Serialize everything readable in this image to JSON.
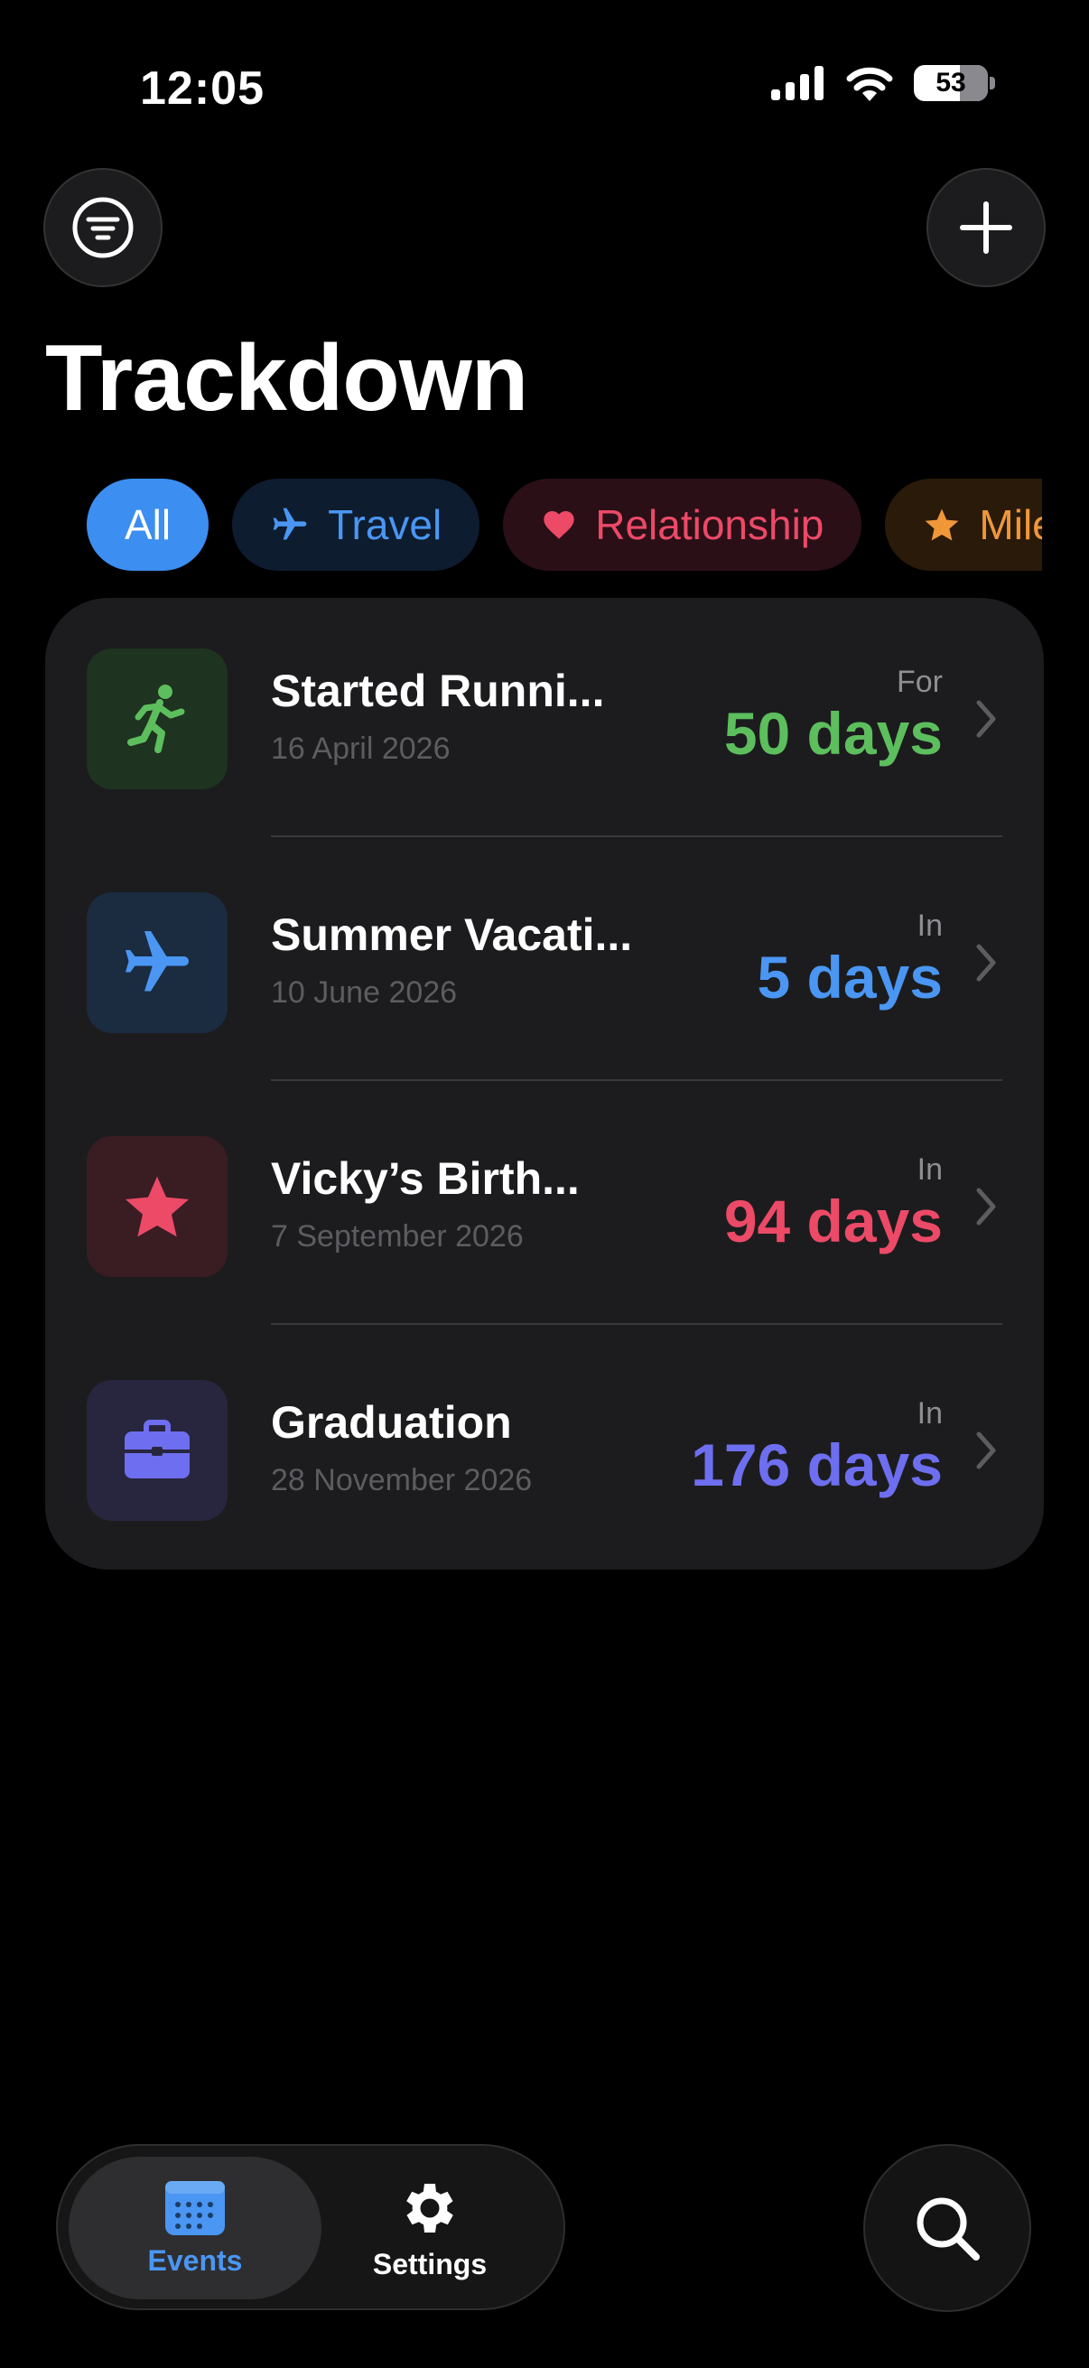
{
  "status": {
    "time": "12:05",
    "battery": "53"
  },
  "header": {
    "title": "Trackdown",
    "filter_icon": "filter-circle-icon",
    "add_icon": "plus-icon"
  },
  "chips": [
    {
      "label": "All",
      "icon": "",
      "color": "#3c8ef0"
    },
    {
      "label": "Travel",
      "icon": "airplane-icon",
      "color": "#4a96f2"
    },
    {
      "label": "Relationship",
      "icon": "heart-icon",
      "color": "#ec4a67"
    },
    {
      "label": "Mile",
      "icon": "star-icon",
      "color": "#f0973a"
    }
  ],
  "events": [
    {
      "name": "Started Runni...",
      "date": "16 April 2026",
      "prefix": "For",
      "count": "50 days",
      "icon": "running-figure-icon",
      "color": "#5dbe5d"
    },
    {
      "name": "Summer Vacati...",
      "date": "10 June 2026",
      "prefix": "In",
      "count": "5 days",
      "icon": "airplane-icon",
      "color": "#4a96f2"
    },
    {
      "name": "Vicky’s Birth...",
      "date": "7 September 2026",
      "prefix": "In",
      "count": "94 days",
      "icon": "star-icon",
      "color": "#ec4a67"
    },
    {
      "name": "Graduation",
      "date": "28 November 2026",
      "prefix": "In",
      "count": "176 days",
      "icon": "briefcase-icon",
      "color": "#6e6ef0"
    }
  ],
  "tabbar": {
    "events_label": "Events",
    "settings_label": "Settings"
  },
  "search": {
    "icon": "magnifying-glass-icon"
  }
}
